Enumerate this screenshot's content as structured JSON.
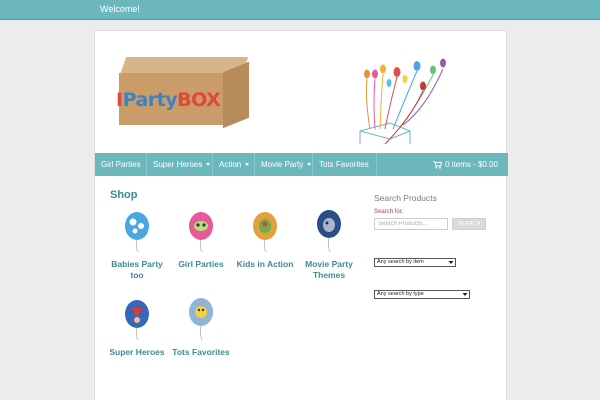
{
  "topbar": {
    "welcome": "Welcome!"
  },
  "logo": {
    "bar": "I",
    "party": "Party",
    "box": "BOX"
  },
  "nav": {
    "items": [
      {
        "label": "Girl Parties"
      },
      {
        "label": "Super Heroes"
      },
      {
        "label": "Action"
      },
      {
        "label": "Movie Party"
      },
      {
        "label": "Tots Favorites"
      }
    ],
    "cart": "0 items - $0.00"
  },
  "shop": {
    "title": "Shop",
    "products": [
      {
        "label": "Babies Party too",
        "color": "#4aa7e0"
      },
      {
        "label": "Girl Parties",
        "color": "#e75a9a"
      },
      {
        "label": "Kids in Action",
        "color": "#e0a23a"
      },
      {
        "label": "Movie Party Themes",
        "color": "#2c4e86"
      },
      {
        "label": "Super Heroes",
        "color": "#3967b8"
      },
      {
        "label": "Tots Favorites",
        "color": "#8fb3d9"
      }
    ]
  },
  "sidebar": {
    "title": "Search Products",
    "search_for": "Search for:",
    "placeholder": "Search Products…",
    "search_button": "SEARCH",
    "select_item": "Any search by item",
    "select_type": "Any search by type"
  },
  "colors": {
    "accent": "#6bb7bc",
    "link": "#3c8b93"
  }
}
